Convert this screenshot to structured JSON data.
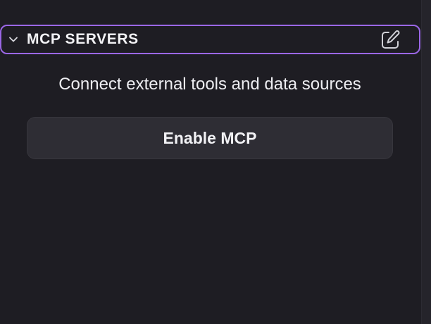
{
  "mcp_section": {
    "title": "MCP SERVERS",
    "chevron_icon": "chevron-down-icon",
    "edit_icon": "edit-icon",
    "description": "Connect external tools and data sources",
    "enable_button_label": "Enable MCP"
  },
  "colors": {
    "background": "#1e1d23",
    "focus_border": "#9b67e6",
    "button_background": "#2e2d34",
    "text": "#ececf1"
  }
}
